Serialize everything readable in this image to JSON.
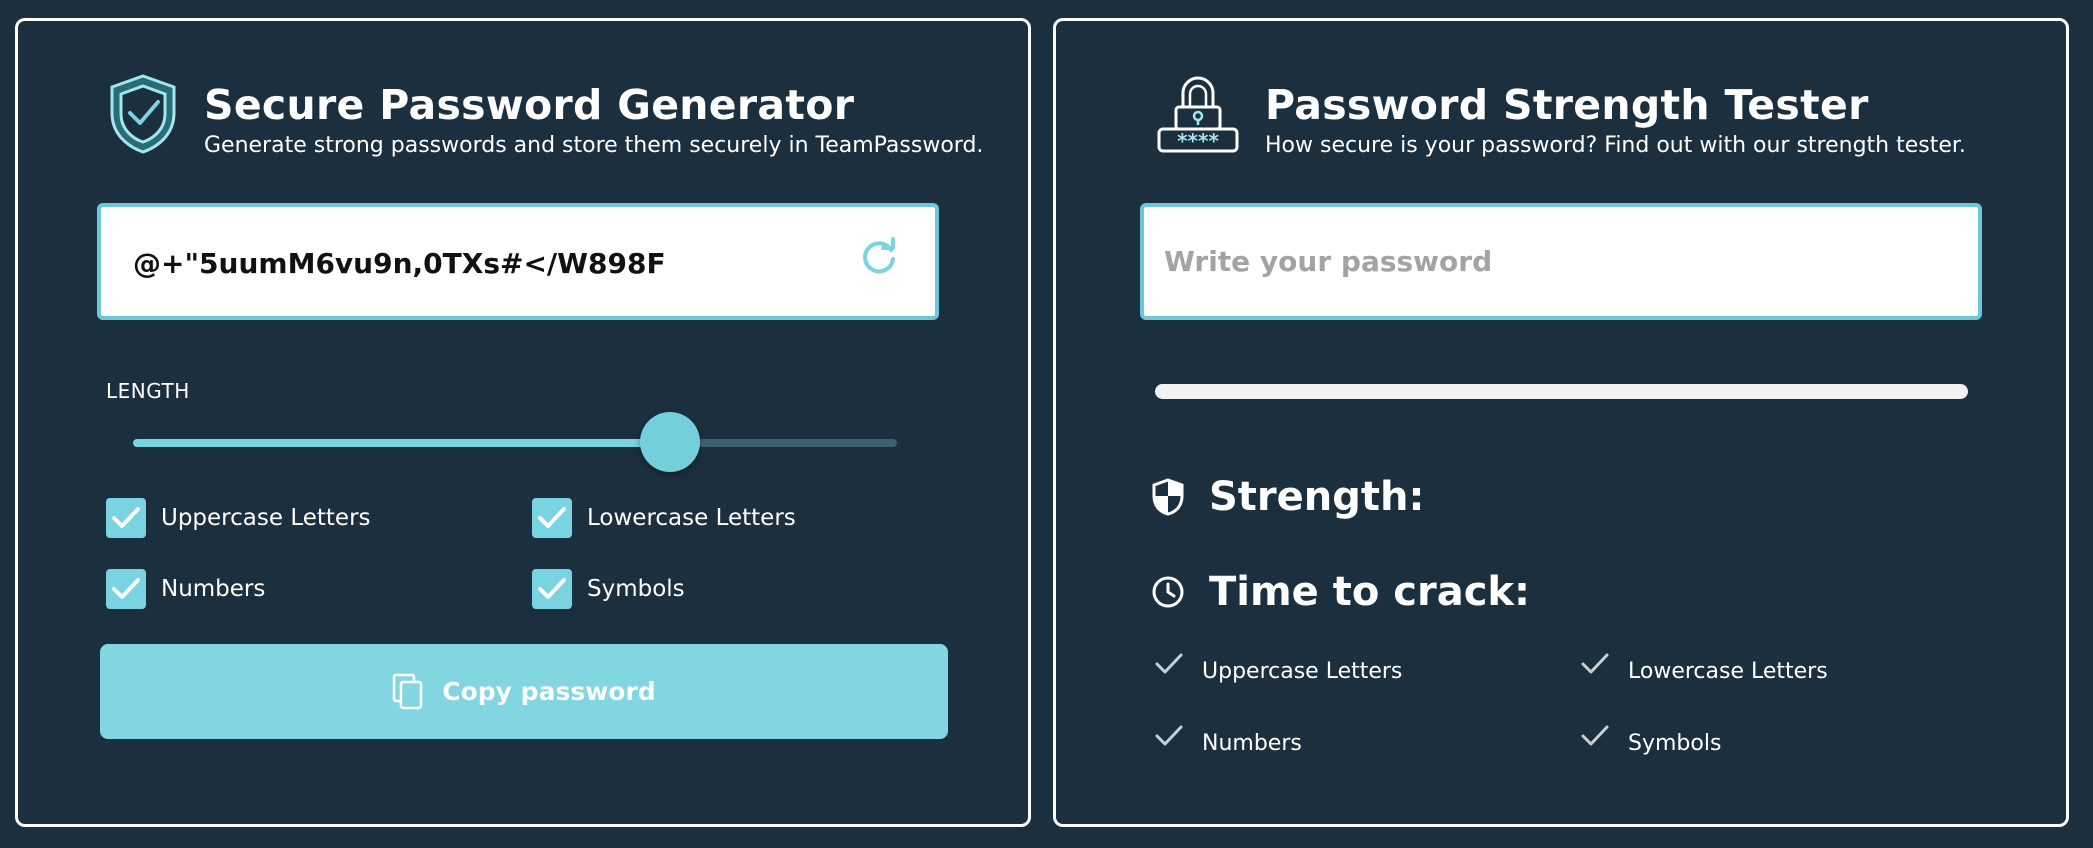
{
  "generator": {
    "title": "Secure Password Generator",
    "subtitle": "Generate strong passwords and store them securely in TeamPassword.",
    "password": "@+\"5uumM6vu9n,0TXs#</W898F",
    "length_label": "LENGTH",
    "length_fraction": 0.703,
    "options": [
      {
        "label": "Uppercase Letters",
        "checked": true
      },
      {
        "label": "Lowercase Letters",
        "checked": true
      },
      {
        "label": "Numbers",
        "checked": true
      },
      {
        "label": "Symbols",
        "checked": true
      }
    ],
    "copy_label": "Copy password"
  },
  "tester": {
    "title": "Password Strength Tester",
    "subtitle": "How secure is your password? Find out with our strength tester.",
    "input_placeholder": "Write your password",
    "input_value": "",
    "strength_label": "Strength:",
    "time_label": "Time to crack:",
    "requirements": [
      {
        "label": "Uppercase Letters"
      },
      {
        "label": "Lowercase Letters"
      },
      {
        "label": "Numbers"
      },
      {
        "label": "Symbols"
      }
    ]
  },
  "colors": {
    "background": "#1c2f3e",
    "accent": "#79d3e0",
    "border": "#ffffff"
  },
  "icons": {
    "generator_header": "shield-check-icon",
    "tester_header": "padlock-password-icon",
    "refresh": "refresh-icon",
    "copy": "copy-icon",
    "strength": "shield-icon",
    "time": "clock-icon",
    "requirement": "checkmark-icon"
  }
}
